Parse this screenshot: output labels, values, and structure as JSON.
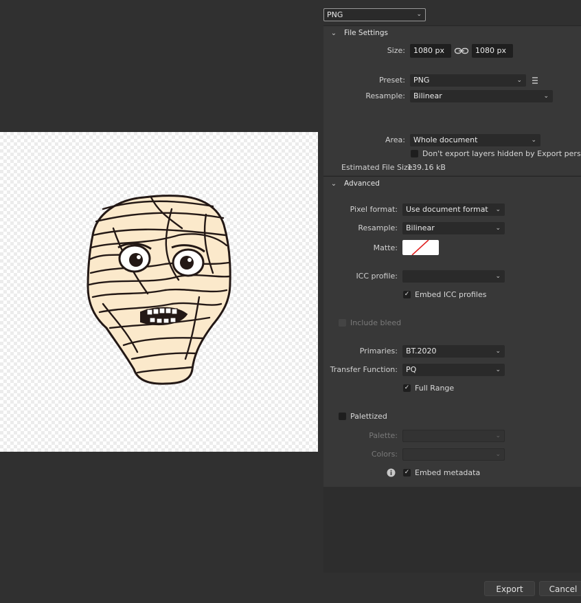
{
  "format_select": {
    "value": "PNG"
  },
  "file_settings": {
    "title": "File Settings",
    "size_label": "Size:",
    "width": "1080 px",
    "height": "1080 px",
    "preset_label": "Preset:",
    "preset_value": "PNG",
    "resample_label": "Resample:",
    "resample_value": "Bilinear",
    "area_label": "Area:",
    "area_value": "Whole document",
    "dont_export_hidden_label": "Don't export layers hidden by Export persona",
    "estimated_size_label": "Estimated File Size:",
    "estimated_size_value": "139.16 kB"
  },
  "advanced": {
    "title": "Advanced",
    "pixel_format_label": "Pixel format:",
    "pixel_format_value": "Use document format",
    "resample_label": "Resample:",
    "resample_value": "Bilinear",
    "matte_label": "Matte:",
    "icc_profile_label": "ICC profile:",
    "icc_profile_value": "",
    "embed_icc_label": "Embed ICC profiles",
    "embed_icc_checked": true,
    "include_bleed_label": "Include bleed",
    "primaries_label": "Primaries:",
    "primaries_value": "BT.2020",
    "transfer_label": "Transfer Function:",
    "transfer_value": "PQ",
    "full_range_label": "Full Range",
    "full_range_checked": true,
    "palettized_label": "Palettized",
    "palette_label": "Palette:",
    "palette_value": "",
    "colors_label": "Colors:",
    "colors_value": "",
    "embed_metadata_label": "Embed metadata",
    "embed_metadata_checked": true
  },
  "buttons": {
    "export": "Export",
    "cancel": "Cancel"
  },
  "icons": {
    "chevron": "chevron-down-icon",
    "link": "link-icon",
    "menu": "hamburger-menu-icon",
    "info": "info-icon",
    "check": "checkmark-icon"
  },
  "colors": {
    "panel": "#383838",
    "background": "#303030",
    "field": "#2a2a2a",
    "mummy_wrap": "#fbe9cb",
    "outline": "#231815"
  }
}
